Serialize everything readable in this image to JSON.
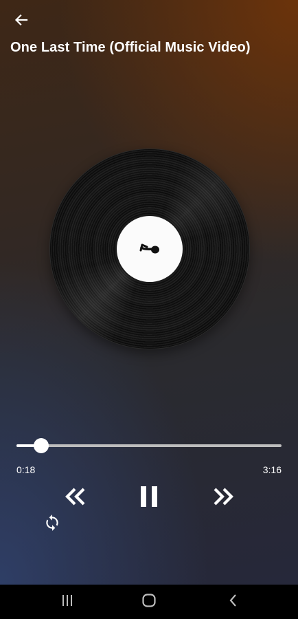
{
  "header": {
    "back_icon": "arrow-left-icon",
    "title": "One Last Time (Official Music Video)"
  },
  "artwork": {
    "type": "vinyl-record",
    "label_icon": "music-note-icon"
  },
  "player": {
    "current_time": "0:18",
    "total_time": "3:16",
    "progress_fraction": 0.092
  },
  "controls": {
    "rewind_icon": "double-chevron-left-icon",
    "pause_icon": "pause-icon",
    "forward_icon": "double-chevron-right-icon",
    "repeat_icon": "repeat-icon"
  },
  "system_nav": {
    "recents_icon": "recents-icon",
    "home_icon": "home-icon",
    "back_icon": "system-back-icon"
  },
  "colors": {
    "accent": "#ffffff",
    "track": "#bdbdbd",
    "nav_bar": "#000000"
  }
}
